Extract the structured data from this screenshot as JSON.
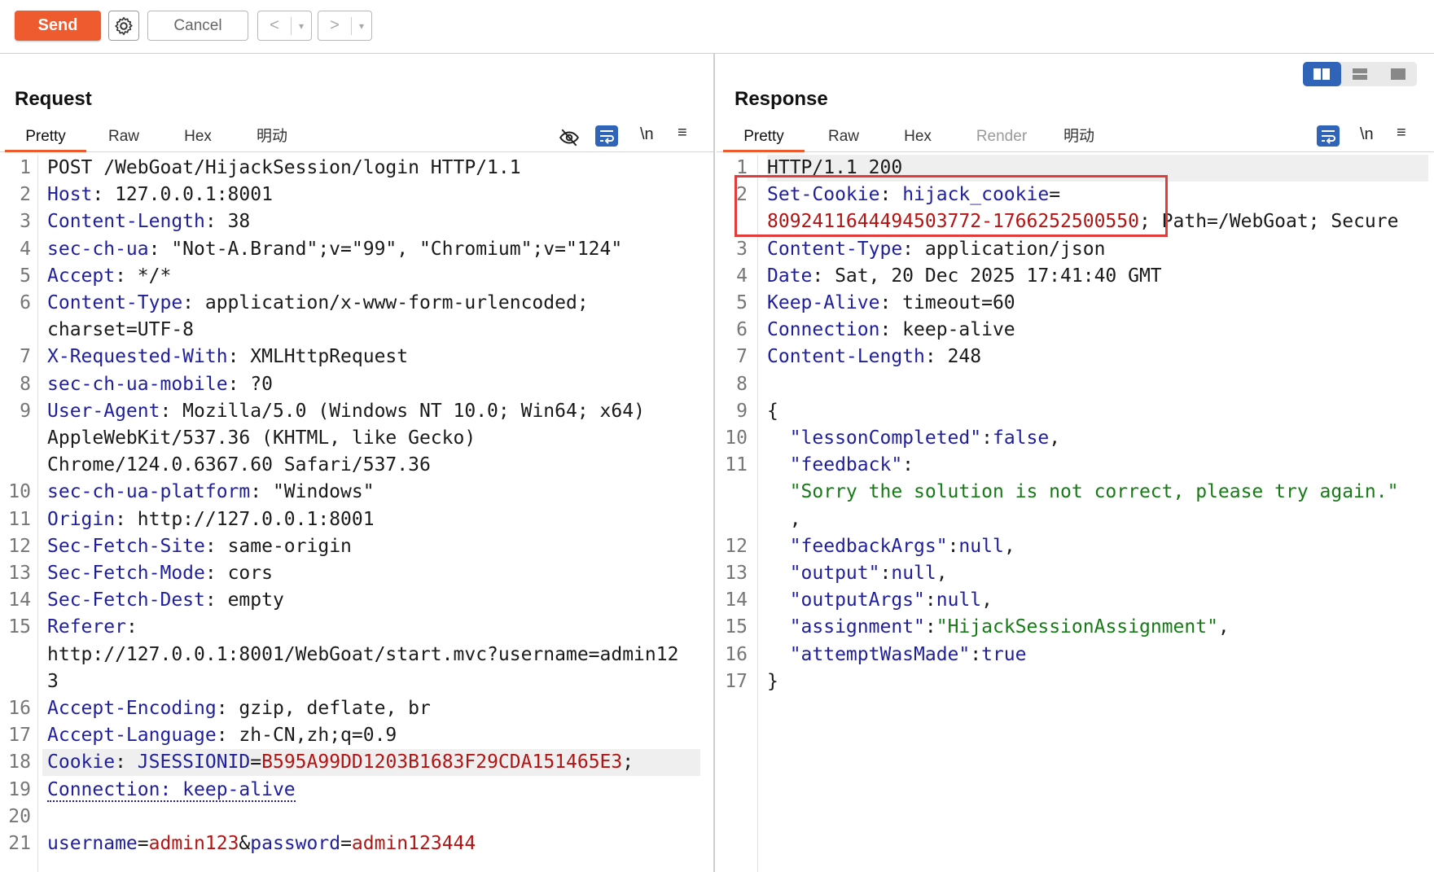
{
  "toolbar": {
    "send_label": "Send",
    "cancel_label": "Cancel",
    "back_glyph": "<",
    "forward_glyph": ">",
    "drop_glyph": "▾"
  },
  "colors": {
    "accent": "#ee5b2f",
    "key": "#1f1f9e",
    "value_red": "#b31312",
    "string_green": "#167a16",
    "highlight_box": "#e23b3b"
  },
  "request": {
    "title": "Request",
    "tabs": [
      "Pretty",
      "Raw",
      "Hex",
      "明动"
    ],
    "active_tab": "Pretty",
    "newline_toggle": "\\n",
    "icons": [
      "eye-off-icon",
      "wrap-lines-icon",
      "newline-icon",
      "menu-icon"
    ],
    "line_numbers": [
      "1",
      "2",
      "3",
      "4",
      "5",
      "6",
      "",
      "7",
      "8",
      "9",
      "",
      "",
      "10",
      "11",
      "12",
      "13",
      "14",
      "15",
      "",
      "",
      "16",
      "17",
      "18",
      "19",
      "20",
      "21"
    ],
    "lines": [
      [
        {
          "t": "POST /WebGoat/HijackSession/login HTTP/1.1"
        }
      ],
      [
        {
          "t": "Host",
          "c": "k"
        },
        {
          "t": ": 127.0.0.1:8001"
        }
      ],
      [
        {
          "t": "Content-Length",
          "c": "k"
        },
        {
          "t": ": 38"
        }
      ],
      [
        {
          "t": "sec-ch-ua",
          "c": "k"
        },
        {
          "t": ": \"Not-A.Brand\";v=\"99\", \"Chromium\";v=\"124\""
        }
      ],
      [
        {
          "t": "Accept",
          "c": "k"
        },
        {
          "t": ": */*"
        }
      ],
      [
        {
          "t": "Content-Type",
          "c": "k"
        },
        {
          "t": ": application/x-www-form-urlencoded;"
        }
      ],
      [
        {
          "t": "charset=UTF-8"
        }
      ],
      [
        {
          "t": "X-Requested-With",
          "c": "k"
        },
        {
          "t": ": XMLHttpRequest"
        }
      ],
      [
        {
          "t": "sec-ch-ua-mobile",
          "c": "k"
        },
        {
          "t": ": ?0"
        }
      ],
      [
        {
          "t": "User-Agent",
          "c": "k"
        },
        {
          "t": ": Mozilla/5.0 (Windows NT 10.0; Win64; x64)"
        }
      ],
      [
        {
          "t": "AppleWebKit/537.36 (KHTML, like Gecko)"
        }
      ],
      [
        {
          "t": "Chrome/124.0.6367.60 Safari/537.36"
        }
      ],
      [
        {
          "t": "sec-ch-ua-platform",
          "c": "k"
        },
        {
          "t": ": \"Windows\""
        }
      ],
      [
        {
          "t": "Origin",
          "c": "k"
        },
        {
          "t": ": http://127.0.0.1:8001"
        }
      ],
      [
        {
          "t": "Sec-Fetch-Site",
          "c": "k"
        },
        {
          "t": ": same-origin"
        }
      ],
      [
        {
          "t": "Sec-Fetch-Mode",
          "c": "k"
        },
        {
          "t": ": cors"
        }
      ],
      [
        {
          "t": "Sec-Fetch-Dest",
          "c": "k"
        },
        {
          "t": ": empty"
        }
      ],
      [
        {
          "t": "Referer",
          "c": "k"
        },
        {
          "t": ":"
        }
      ],
      [
        {
          "t": "http://127.0.0.1:8001/WebGoat/start.mvc?username=admin12"
        }
      ],
      [
        {
          "t": "3"
        }
      ],
      [
        {
          "t": "Accept-Encoding",
          "c": "k"
        },
        {
          "t": ": gzip, deflate, br"
        }
      ],
      [
        {
          "t": "Accept-Language",
          "c": "k"
        },
        {
          "t": ": zh-CN,zh;q=0.9"
        }
      ],
      [
        {
          "t": "Cookie",
          "c": "k"
        },
        {
          "t": ": "
        },
        {
          "t": "JSESSIONID",
          "c": "k"
        },
        {
          "t": "="
        },
        {
          "t": "B595A99DD1203B1683F29CDA151465E3",
          "c": "r"
        },
        {
          "t": ";"
        }
      ],
      [
        {
          "t": "Connection: keep-alive",
          "c": "k",
          "u": true
        }
      ],
      [],
      [
        {
          "t": "username",
          "c": "k"
        },
        {
          "t": "="
        },
        {
          "t": "admin123",
          "c": "r"
        },
        {
          "t": "&"
        },
        {
          "t": "password",
          "c": "k"
        },
        {
          "t": "="
        },
        {
          "t": "admin123444",
          "c": "r"
        }
      ]
    ]
  },
  "response": {
    "title": "Response",
    "tabs": [
      "Pretty",
      "Raw",
      "Hex",
      "Render",
      "明动"
    ],
    "active_tab": "Pretty",
    "disabled_tab": "Render",
    "newline_toggle": "\\n",
    "layout_modes": [
      "split-horizontal-icon",
      "split-vertical-icon",
      "single-pane-icon"
    ],
    "line_numbers": [
      "1",
      "2",
      "",
      "3",
      "4",
      "5",
      "6",
      "7",
      "8",
      "9",
      "10",
      "11",
      "",
      "",
      "12",
      "13",
      "14",
      "15",
      "16",
      "17"
    ],
    "lines": [
      [
        {
          "t": "HTTP/1.1 200"
        }
      ],
      [
        {
          "t": "Set-Cookie",
          "c": "k"
        },
        {
          "t": ": "
        },
        {
          "t": "hijack_cookie",
          "c": "k"
        },
        {
          "t": "="
        }
      ],
      [
        {
          "t": "8092411644494503772-1766252500550",
          "c": "r"
        },
        {
          "t": "; Path=/WebGoat; Secure"
        }
      ],
      [
        {
          "t": "Content-Type",
          "c": "k"
        },
        {
          "t": ": application/json"
        }
      ],
      [
        {
          "t": "Date",
          "c": "k"
        },
        {
          "t": ": Sat, 20 Dec 2025 17:41:40 GMT"
        }
      ],
      [
        {
          "t": "Keep-Alive",
          "c": "k"
        },
        {
          "t": ": timeout=60"
        }
      ],
      [
        {
          "t": "Connection",
          "c": "k"
        },
        {
          "t": ": keep-alive"
        }
      ],
      [
        {
          "t": "Content-Length",
          "c": "k"
        },
        {
          "t": ": 248"
        }
      ],
      [],
      [
        {
          "t": "{"
        }
      ],
      [
        {
          "t": "  \"lessonCompleted\"",
          "c": "k"
        },
        {
          "t": ":"
        },
        {
          "t": "false",
          "c": "k"
        },
        {
          "t": ","
        }
      ],
      [
        {
          "t": "  \"feedback\"",
          "c": "k"
        },
        {
          "t": ":"
        }
      ],
      [
        {
          "t": "  \"Sorry the solution is not correct, please try again.\"",
          "c": "g"
        }
      ],
      [
        {
          "t": "  ,"
        }
      ],
      [
        {
          "t": "  \"feedbackArgs\"",
          "c": "k"
        },
        {
          "t": ":"
        },
        {
          "t": "null",
          "c": "k"
        },
        {
          "t": ","
        }
      ],
      [
        {
          "t": "  \"output\"",
          "c": "k"
        },
        {
          "t": ":"
        },
        {
          "t": "null",
          "c": "k"
        },
        {
          "t": ","
        }
      ],
      [
        {
          "t": "  \"outputArgs\"",
          "c": "k"
        },
        {
          "t": ":"
        },
        {
          "t": "null",
          "c": "k"
        },
        {
          "t": ","
        }
      ],
      [
        {
          "t": "  \"assignment\"",
          "c": "k"
        },
        {
          "t": ":"
        },
        {
          "t": "\"HijackSessionAssignment\"",
          "c": "g"
        },
        {
          "t": ","
        }
      ],
      [
        {
          "t": "  \"attemptWasMade\"",
          "c": "k"
        },
        {
          "t": ":"
        },
        {
          "t": "true",
          "c": "k"
        }
      ],
      [
        {
          "t": "}"
        }
      ]
    ]
  }
}
